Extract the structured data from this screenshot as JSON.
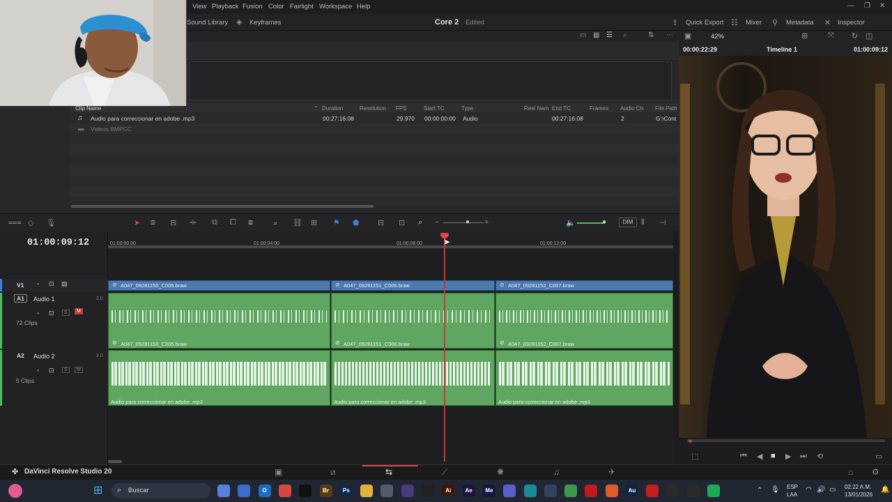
{
  "menu": [
    "View",
    "Playback",
    "Fusion",
    "Color",
    "Fairlight",
    "Workspace",
    "Help"
  ],
  "toolbar": {
    "sound_library": "Sound Library",
    "keyframes": "Keyframes",
    "project_title": "Core 2",
    "project_status": "Edited",
    "quick_export": "Quick Export",
    "mixer": "Mixer",
    "metadata": "Metadata",
    "inspector": "Inspector"
  },
  "viewer": {
    "zoom": "42%",
    "timecode_left": "00:00:22:29",
    "timeline_name": "Timeline 1",
    "timecode_right": "01:00:09:12"
  },
  "media_pool": {
    "columns": [
      "Clip Name",
      "Duration",
      "Resolution",
      "FPS",
      "Start TC",
      "Type",
      "Reel Nam",
      "End TC",
      "Frames",
      "Audio Ch",
      "File Path"
    ],
    "rows": [
      {
        "name": "Audio para correccionar en adobe .mp3",
        "duration": "00:27:16:08",
        "fps": "29.970",
        "start_tc": "00:00:00:00",
        "type": "Audio",
        "end_tc": "00:27:16:08",
        "audio_ch": "2",
        "file_path": "G:\\Cont"
      },
      {
        "name": "Videos BMPCC"
      }
    ]
  },
  "timeline": {
    "timecode": "01:00:09:12",
    "ruler": [
      "01:00:00:00",
      "01:00:04:00",
      "01:00:08:00",
      "01:00:12:00"
    ],
    "dim_label": "DIM",
    "tracks": {
      "v1": {
        "id": "V1"
      },
      "a1": {
        "id": "A1",
        "name": "Audio 1",
        "level": "2.0",
        "clips": "72 Clips",
        "s": "S",
        "m": "M"
      },
      "a2": {
        "id": "A2",
        "name": "Audio 2",
        "level": "2.0",
        "clips": "5 Clips",
        "s": "S",
        "m": "M"
      }
    },
    "video_clips": [
      "A047_09281150_C005.braw",
      "A047_09281151_C006.braw",
      "A047_09281152_C007.braw"
    ],
    "a1_clips": [
      "A047_09281150_C005.braw",
      "A047_09281151_C006.braw",
      "A047_09281152_C007.braw"
    ],
    "a2_clips": [
      "Audio para correccionar en adobe .mp3",
      "Audio para correccionar en adobe .mp3",
      "Audio para correccionar en adobe .mp3"
    ]
  },
  "pagebar": {
    "app_name": "DaVinci Resolve Studio 20"
  },
  "taskbar": {
    "search": "Buscar",
    "lang_top": "ESP",
    "lang_bottom": "LAA",
    "time": "02:22 A.M.",
    "date": "13/01/2026",
    "apps": [
      {
        "icon": "copilot-icon",
        "color": "#5b7fe0",
        "text": ""
      },
      {
        "icon": "store-icon",
        "color": "#3d6bd0",
        "text": ""
      },
      {
        "icon": "outlook-icon",
        "color": "#1b6ec2",
        "text": "O"
      },
      {
        "icon": "chrome-icon",
        "color": "#d9463b",
        "text": ""
      },
      {
        "icon": "tiktok-icon",
        "color": "#111111",
        "text": ""
      },
      {
        "icon": "bridge-icon",
        "color": "#5a3b10",
        "text": "Br"
      },
      {
        "icon": "photoshop-icon",
        "color": "#0c2a4d",
        "text": "Ps"
      },
      {
        "icon": "explorer-icon",
        "color": "#e1b33c",
        "text": ""
      },
      {
        "icon": "settings-icon",
        "color": "#555c69",
        "text": ""
      },
      {
        "icon": "obs-icon",
        "color": "#4a3c78",
        "text": ""
      },
      {
        "icon": "capcut-icon",
        "color": "#222222",
        "text": ""
      },
      {
        "icon": "illustrator-icon",
        "color": "#3a1a06",
        "text": "Ai"
      },
      {
        "icon": "aftereffects-icon",
        "color": "#1d1440",
        "text": "Ae"
      },
      {
        "icon": "mediaencoder-icon",
        "color": "#111a3d",
        "text": "Me"
      },
      {
        "icon": "teams-icon",
        "color": "#5b5fc7",
        "text": ""
      },
      {
        "icon": "edge-icon",
        "color": "#1a8a9e",
        "text": ""
      },
      {
        "icon": "resolve-icon",
        "color": "#334060",
        "text": ""
      },
      {
        "icon": "chrome2-icon",
        "color": "#3c9a4a",
        "text": ""
      },
      {
        "icon": "opera-icon",
        "color": "#c21b1b",
        "text": ""
      },
      {
        "icon": "brave-icon",
        "color": "#e05a2b",
        "text": ""
      },
      {
        "icon": "audition-icon",
        "color": "#0f2440",
        "text": "Au"
      },
      {
        "icon": "acrobat-icon",
        "color": "#c41e1e",
        "text": ""
      },
      {
        "icon": "gear-app-icon",
        "color": "#2b2b2b",
        "text": ""
      },
      {
        "icon": "capture-icon",
        "color": "#2b2b2b",
        "text": ""
      },
      {
        "icon": "whatsapp-icon",
        "color": "#1fa855",
        "text": ""
      }
    ]
  }
}
